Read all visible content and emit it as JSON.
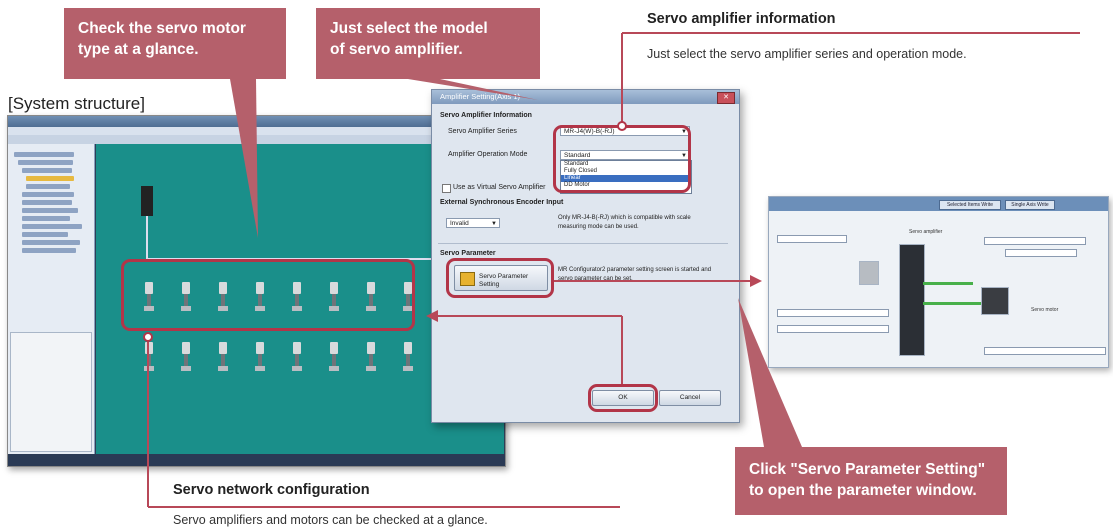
{
  "callouts": {
    "motor_type": {
      "line1": "Check the servo motor",
      "line2": "type at a glance."
    },
    "select_model": {
      "line1": "Just select the model",
      "line2": "of servo amplifier."
    },
    "param_setting": {
      "line1": "Click \"Servo Parameter Setting\"",
      "line2": "to open the parameter window."
    }
  },
  "system_structure_label": "[System structure]",
  "servo_amp_info": {
    "title": "Servo amplifier information",
    "text": "Just select the servo amplifier series and operation mode."
  },
  "servo_network": {
    "title": "Servo network configuration",
    "text": "Servo amplifiers and motors can be checked at a glance."
  },
  "dialog": {
    "title": "Amplifier Setting(Axis 1)",
    "section_info": "Servo Amplifier Information",
    "series_label": "Servo Amplifier Series",
    "series_value": "MR-J4(W)-B(-RJ)",
    "mode_label": "Amplifier Operation Mode",
    "mode_value": "Standard",
    "mode_options": [
      "Standard",
      "Fully Closed",
      "Linear",
      "DD Motor"
    ],
    "virtual_label": "Use as Virtual Servo Amplifier",
    "encoder_section": "External Synchronous Encoder Input",
    "encoder_value": "Invalid",
    "encoder_note": "Only MR-J4-B(-RJ) which is compatible with scale measuring mode can be used.",
    "param_section": "Servo Parameter",
    "param_button": "Servo Parameter Setting",
    "param_note": "MR Configurator2 parameter setting screen is started and servo parameter can be set.",
    "ok_label": "OK",
    "cancel_label": "Cancel"
  },
  "paramwin": {
    "tab1": "Selected Items Write",
    "tab2": "Single Axis Write",
    "amp_label": "Servo amplifier",
    "motor_label": "Servo motor"
  }
}
